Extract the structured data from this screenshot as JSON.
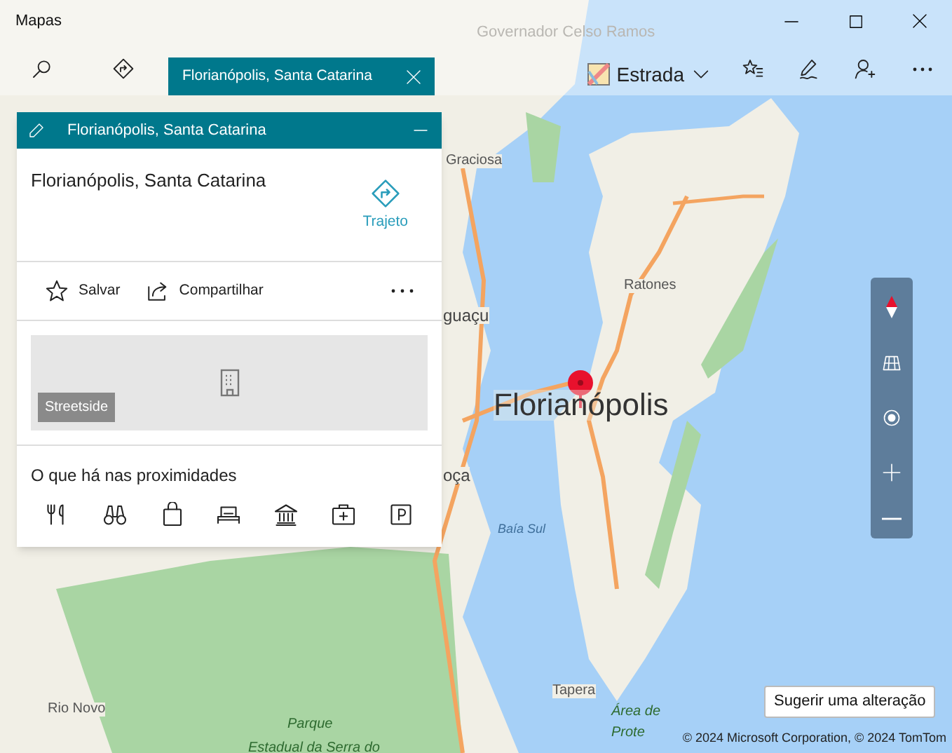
{
  "window": {
    "title": "Mapas"
  },
  "search_tab": {
    "label": "Florianópolis, Santa Catarina",
    "selected": true
  },
  "map_style": {
    "label": "Estrada"
  },
  "card": {
    "header": "Florianópolis, Santa Catarina",
    "place": "Florianópolis, Santa Catarina",
    "directions": "Trajeto",
    "actions": [
      "Salvar",
      "Compartilhar"
    ],
    "streetside": "Streetside",
    "nearby_title": "O que há nas proximidades"
  },
  "map_labels": [
    {
      "text": "Governador Celso Ramos",
      "kind": "faint"
    },
    {
      "text": "Graciosa",
      "kind": "place"
    },
    {
      "text": "guaçu",
      "kind": "town"
    },
    {
      "text": "Ratones",
      "kind": "place"
    },
    {
      "text": "Florianópolis",
      "kind": "city"
    },
    {
      "text": "oça",
      "kind": "town"
    },
    {
      "text": "Baía Sul",
      "kind": "water"
    },
    {
      "text": "Rio Novo",
      "kind": "place"
    },
    {
      "text": "Tapera",
      "kind": "place"
    },
    {
      "text": "Parque",
      "kind": "park"
    },
    {
      "text": "Estadual da Serra do",
      "kind": "park"
    },
    {
      "text": "Área de",
      "kind": "park"
    },
    {
      "text": "Prote",
      "kind": "park"
    }
  ],
  "suggest_button": "Sugerir uma alteração",
  "copyright": "© 2024 Microsoft Corporation, © 2024 TomTom"
}
